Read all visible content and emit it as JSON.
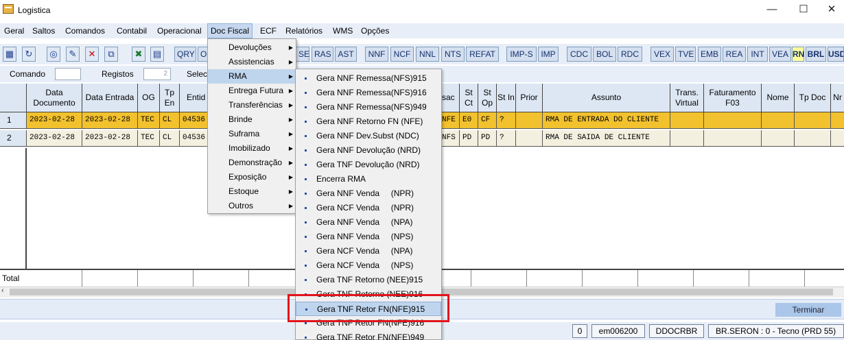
{
  "window": {
    "title": "Logistica",
    "minimize": "—",
    "maximize": "☐",
    "close": "✕"
  },
  "menubar": [
    "Geral",
    "Saltos",
    "Comandos",
    "Contabil",
    "Operacional",
    "Doc Fiscal",
    "ECF",
    "Relatórios",
    "WMS",
    "Opções"
  ],
  "toolbar": {
    "icons": [
      "open-doc-icon",
      "refresh-icon",
      "view-icon",
      "edit-icon",
      "delete-icon",
      "copy-icon",
      "excel-icon",
      "report-icon"
    ],
    "buttons": [
      "QRY",
      "O",
      "SE",
      "RAS",
      "AST",
      "NNF",
      "NCF",
      "NNL",
      "NTS",
      "REFAT",
      "IMP-S",
      "IMP",
      "CDC",
      "BOL",
      "RDC",
      "VEX",
      "TVE",
      "EMB",
      "REA",
      "INT",
      "VEA",
      "RN",
      "BRL",
      "USD"
    ]
  },
  "filter": {
    "comando_label": "Comando",
    "comando_value": "",
    "registos_label": "Registos",
    "registos_value": "2",
    "selec_label": "Selec"
  },
  "table": {
    "headers": [
      "Data Documento",
      "Data Entrada",
      "OG",
      "Tp En",
      "Entid",
      "sac",
      "St Ct",
      "St Op",
      "St In",
      "Prior",
      "Assunto",
      "Trans. Virtual",
      "Faturamento F03",
      "Nome",
      "Tp Doc",
      "Nr"
    ],
    "rows": [
      {
        "n": "1",
        "data_doc": "2023-02-28",
        "data_ent": "2023-02-28",
        "og": "TEC",
        "tp": "CL",
        "entid": "04536",
        "sac": "NFE",
        "stct": "E0",
        "stop": "CF",
        "stin": "?",
        "prior": "",
        "assunto": "RMA DE ENTRADA DO CLIENTE"
      },
      {
        "n": "2",
        "data_doc": "2023-02-28",
        "data_ent": "2023-02-28",
        "og": "TEC",
        "tp": "CL",
        "entid": "04536",
        "sac": "NFS",
        "stct": "PD",
        "stop": "PD",
        "stin": "?",
        "prior": "",
        "assunto": "RMA DE SAIDA DE CLIENTE"
      }
    ],
    "total_label": "Total"
  },
  "menu_doc_fiscal": [
    "Devoluções",
    "Assistencias",
    "RMA",
    "Entrega Futura",
    "Transferências",
    "Brinde",
    "Suframa",
    "Imobilizado",
    "Demonstração",
    "Exposição",
    "Estoque",
    "Outros"
  ],
  "menu_rma": [
    "Gera NNF Remessa(NFS)915",
    "Gera NNF Remessa(NFS)916",
    "Gera NNF Remessa(NFS)949",
    "Gera NNF Retorno FN (NFE)",
    "Gera NNF Dev.Subst (NDC)",
    "Gera NNF Devolução (NRD)",
    "Gera TNF Devolução (NRD)",
    "Encerra RMA",
    "Gera NNF Venda     (NPR)",
    "Gera NCF Venda     (NPR)",
    "Gera NNF Venda     (NPA)",
    "Gera NNF Venda     (NPS)",
    "Gera NCF Venda     (NPA)",
    "Gera NCF Venda     (NPS)",
    "Gera TNF Retorno (NEE)915",
    "Gera TNF Retorno (NEE)916",
    "Gera TNF Retor FN(NFE)915",
    "Gera TNF Retor FN(NFE)916",
    "Gera TNF Retor FN(NFE)949"
  ],
  "terminar": "Terminar",
  "status": [
    "0",
    "em006200",
    "DDOCRBR",
    "BR.SERON : 0 - Tecno (PRD 55)"
  ],
  "colors": {
    "row_selected": "#f2c12e",
    "highlight": "#bfd5ee",
    "annotation": "#e0151c"
  }
}
